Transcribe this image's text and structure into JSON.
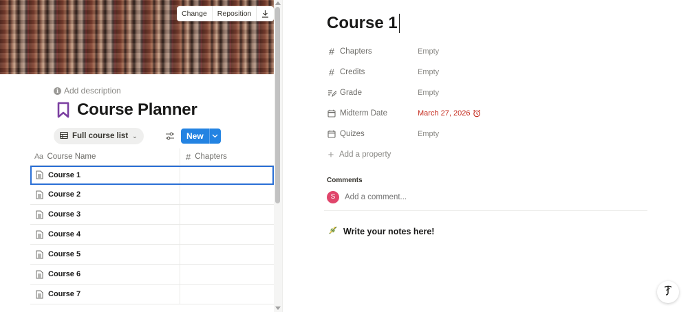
{
  "cover": {
    "actions": [
      "Change",
      "Reposition"
    ],
    "download_icon": "download-icon"
  },
  "database": {
    "add_description": "Add description",
    "title": "Course Planner",
    "title_icon": "bookmark-icon",
    "title_icon_color": "#7b3fa1",
    "view_label": "Full course list",
    "new_label": "New",
    "accent": "#2383e2",
    "columns": {
      "name_icon": "Aa",
      "name": "Course Name",
      "chapters_icon": "#",
      "chapters": "Chapters"
    },
    "rows": [
      {
        "name": "Course 1"
      },
      {
        "name": "Course 2"
      },
      {
        "name": "Course 3"
      },
      {
        "name": "Course 4"
      },
      {
        "name": "Course 5"
      },
      {
        "name": "Course 6"
      },
      {
        "name": "Course 7"
      }
    ]
  },
  "page": {
    "title": "Course 1",
    "properties": [
      {
        "icon": "#",
        "name": "Chapters",
        "value": "Empty"
      },
      {
        "icon": "#",
        "name": "Credits",
        "value": "Empty"
      },
      {
        "icon": "grade-icon",
        "name": "Grade",
        "value": "Empty"
      },
      {
        "icon": "calendar-icon",
        "name": "Midterm Date",
        "value": "March 27, 2026"
      },
      {
        "icon": "calendar-icon",
        "name": "Quizes",
        "value": "Empty"
      }
    ],
    "add_property": "Add a property",
    "comments_label": "Comments",
    "avatar_letter": "S",
    "avatar_color": "#e0456b",
    "comment_placeholder": "Add a comment...",
    "notes_heading": "Write your notes here!",
    "date_color": "#c4291c"
  },
  "help_glyph": "?"
}
